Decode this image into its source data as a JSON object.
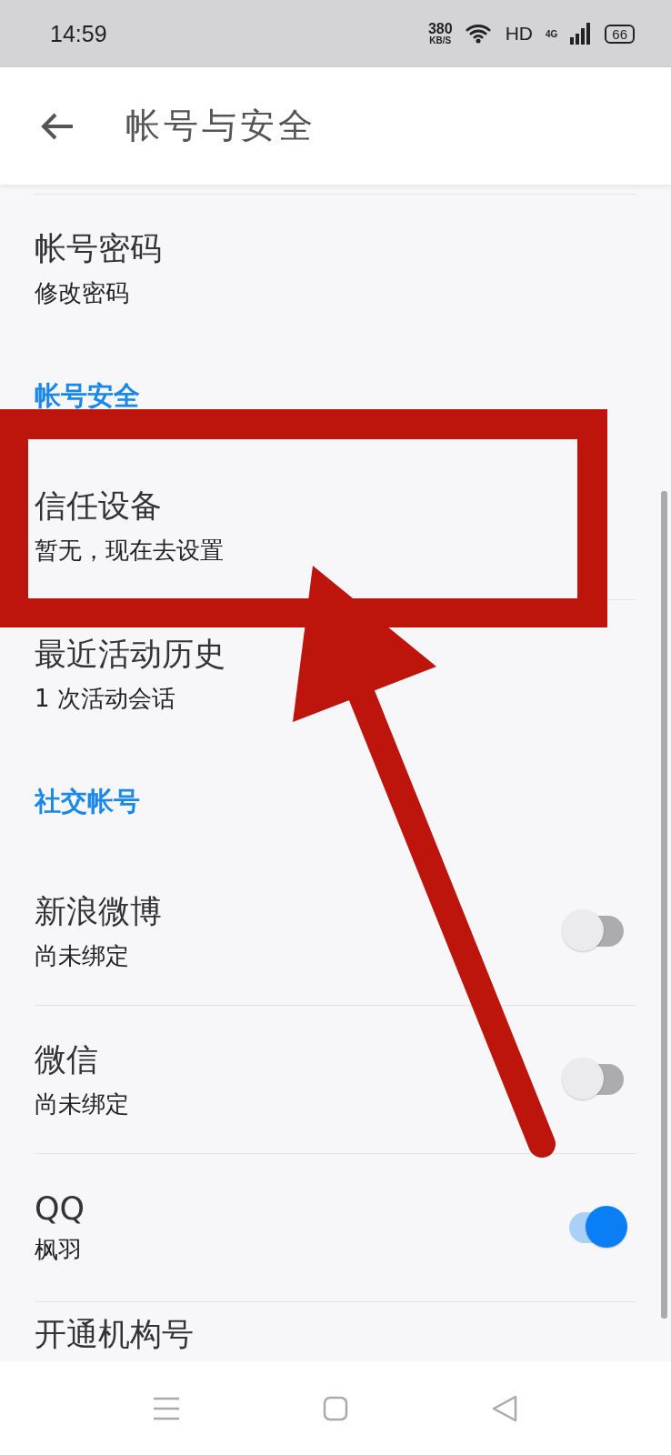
{
  "status_bar": {
    "time": "14:59",
    "net_speed": "380",
    "net_unit": "KB/S",
    "hd": "HD",
    "network": "4G",
    "battery": "66"
  },
  "app_bar": {
    "title": "帐号与安全"
  },
  "groups": [
    {
      "items": [
        {
          "kind": "link",
          "title": "帐号密码",
          "subtitle": "修改密码"
        }
      ]
    },
    {
      "header": "帐号安全",
      "items": [
        {
          "kind": "link",
          "title": "信任设备",
          "subtitle": "暂无，现在去设置"
        },
        {
          "kind": "link",
          "title": "最近活动历史",
          "subtitle": "1 次活动会话"
        }
      ]
    },
    {
      "header": "社交帐号",
      "items": [
        {
          "kind": "toggle",
          "title": "新浪微博",
          "subtitle": "尚未绑定",
          "on": false
        },
        {
          "kind": "toggle",
          "title": "微信",
          "subtitle": "尚未绑定",
          "on": false
        },
        {
          "kind": "toggle",
          "title": "QQ",
          "subtitle": "枫羽",
          "on": true
        },
        {
          "kind": "link",
          "title": "开通机构号"
        }
      ]
    }
  ]
}
